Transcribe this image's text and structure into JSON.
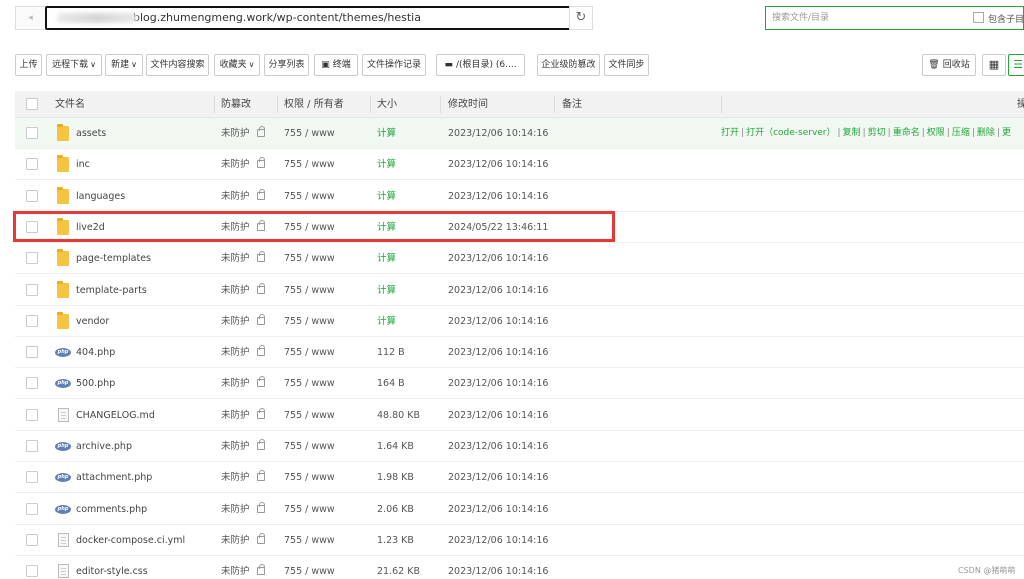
{
  "address": {
    "path": "blog.zhumengmeng.work/wp-content/themes/hestia",
    "search_placeholder": "搜索文件/目录",
    "include_sub_label": "包含子目"
  },
  "toolbar": {
    "upload": "上传",
    "remote_download": "远程下载",
    "new": "新建",
    "content_search": "文件内容搜索",
    "favorites": "收藏夹",
    "share_list": "分享列表",
    "terminal": "终端",
    "op_log": "文件操作记录",
    "disk": "/(根目录) (6....",
    "tamper": "企业级防篡改",
    "sync": "文件同步",
    "recycle": "回收站"
  },
  "columns": {
    "name": "文件名",
    "tamper": "防篡改",
    "perm": "权限 / 所有者",
    "size": "大小",
    "mtime": "修改时间",
    "remark": "备注",
    "ops": "操"
  },
  "ops_links": [
    "打开",
    "打开（code-server）",
    "复制",
    "剪切",
    "重命名",
    "权限",
    "压缩",
    "删除",
    "更"
  ],
  "rows": [
    {
      "type": "folder",
      "name": "assets",
      "tamper": "未防护",
      "perm": "755 / www",
      "size": "计算",
      "mtime": "2023/12/06 10:14:16"
    },
    {
      "type": "folder",
      "name": "inc",
      "tamper": "未防护",
      "perm": "755 / www",
      "size": "计算",
      "mtime": "2023/12/06 10:14:16"
    },
    {
      "type": "folder",
      "name": "languages",
      "tamper": "未防护",
      "perm": "755 / www",
      "size": "计算",
      "mtime": "2023/12/06 10:14:16"
    },
    {
      "type": "folder",
      "name": "live2d",
      "tamper": "未防护",
      "perm": "755 / www",
      "size": "计算",
      "mtime": "2024/05/22 13:46:11"
    },
    {
      "type": "folder",
      "name": "page-templates",
      "tamper": "未防护",
      "perm": "755 / www",
      "size": "计算",
      "mtime": "2023/12/06 10:14:16"
    },
    {
      "type": "folder",
      "name": "template-parts",
      "tamper": "未防护",
      "perm": "755 / www",
      "size": "计算",
      "mtime": "2023/12/06 10:14:16"
    },
    {
      "type": "folder",
      "name": "vendor",
      "tamper": "未防护",
      "perm": "755 / www",
      "size": "计算",
      "mtime": "2023/12/06 10:14:16"
    },
    {
      "type": "php",
      "name": "404.php",
      "tamper": "未防护",
      "perm": "755 / www",
      "size": "112 B",
      "mtime": "2023/12/06 10:14:16"
    },
    {
      "type": "php",
      "name": "500.php",
      "tamper": "未防护",
      "perm": "755 / www",
      "size": "164 B",
      "mtime": "2023/12/06 10:14:16"
    },
    {
      "type": "doc",
      "name": "CHANGELOG.md",
      "tamper": "未防护",
      "perm": "755 / www",
      "size": "48.80 KB",
      "mtime": "2023/12/06 10:14:16"
    },
    {
      "type": "php",
      "name": "archive.php",
      "tamper": "未防护",
      "perm": "755 / www",
      "size": "1.64 KB",
      "mtime": "2023/12/06 10:14:16"
    },
    {
      "type": "php",
      "name": "attachment.php",
      "tamper": "未防护",
      "perm": "755 / www",
      "size": "1.98 KB",
      "mtime": "2023/12/06 10:14:16"
    },
    {
      "type": "php",
      "name": "comments.php",
      "tamper": "未防护",
      "perm": "755 / www",
      "size": "2.06 KB",
      "mtime": "2023/12/06 10:14:16"
    },
    {
      "type": "doc",
      "name": "docker-compose.ci.yml",
      "tamper": "未防护",
      "perm": "755 / www",
      "size": "1.23 KB",
      "mtime": "2023/12/06 10:14:16"
    },
    {
      "type": "doc",
      "name": "editor-style.css",
      "tamper": "未防护",
      "perm": "755 / www",
      "size": "21.62 KB",
      "mtime": "2023/12/06 10:14:16"
    }
  ],
  "watermark": "CSDN @猪萌萌"
}
